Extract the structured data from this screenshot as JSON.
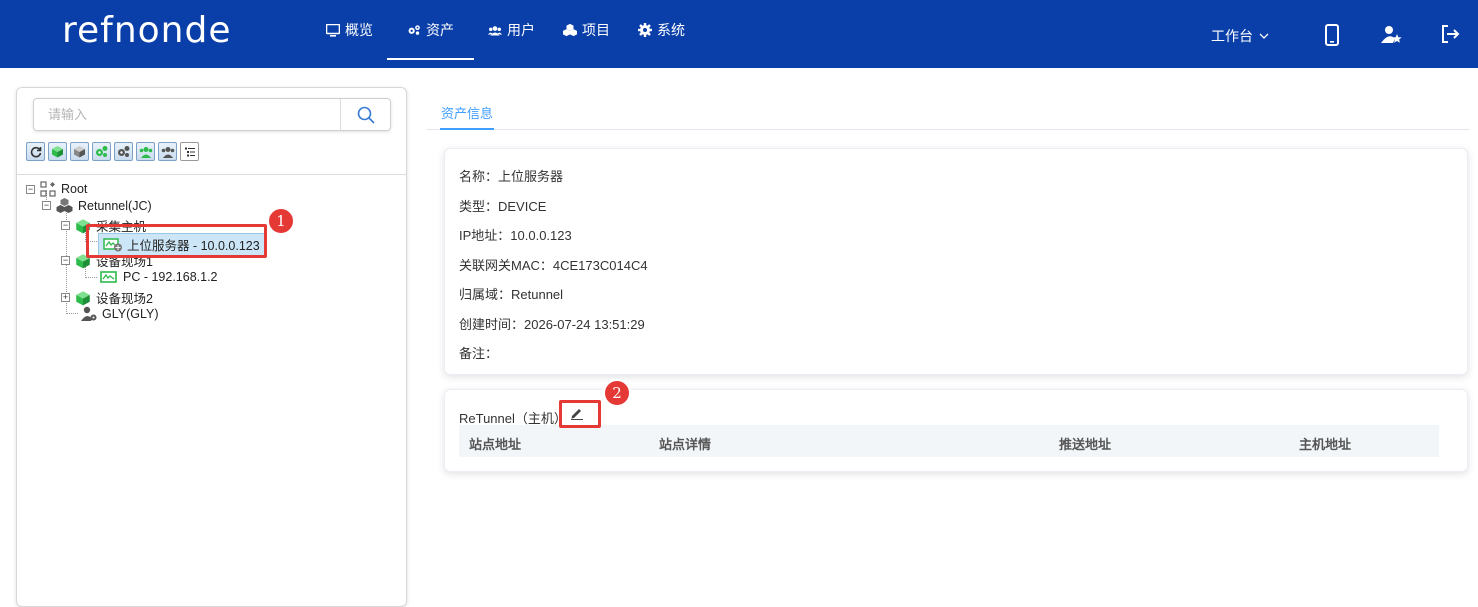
{
  "app": {
    "logo_text": "refnonde"
  },
  "nav": {
    "items": [
      {
        "label": "概览",
        "icon": "monitor-icon"
      },
      {
        "label": "资产",
        "icon": "gears-icon"
      },
      {
        "label": "用户",
        "icon": "users-icon"
      },
      {
        "label": "项目",
        "icon": "cubes-icon"
      },
      {
        "label": "系统",
        "icon": "gear-icon"
      }
    ],
    "active": "资产",
    "workbench_label": "工作台",
    "right_icons": [
      "mobile-icon",
      "user-star-icon",
      "logout-icon"
    ]
  },
  "search": {
    "placeholder": "请输入",
    "value": ""
  },
  "toolbar": {
    "buttons": [
      "refresh-icon",
      "add-green-cube-icon",
      "add-gray-cube-icon",
      "add-green-gears-icon",
      "add-gray-gears-icon",
      "add-green-users-icon",
      "add-gray-users-icon",
      "list-icon"
    ]
  },
  "tree": {
    "root": "Root",
    "retunnel": "Retunnel(JC)",
    "collector": "采集主机",
    "server": "上位服务器 - 10.0.0.123",
    "site1": "设备现场1",
    "pc": "PC - 192.168.1.2",
    "site2": "设备现场2",
    "gly": "GLY(GLY)"
  },
  "annotations": {
    "badge1": "1",
    "badge2": "2"
  },
  "tabs": {
    "asset_info": "资产信息"
  },
  "asset": {
    "name": "名称：上位服务器",
    "type": "类型：DEVICE",
    "ip": "IP地址：10.0.0.123",
    "mac": "关联网关MAC：4CE173C014C4",
    "domain": "归属域：Retunnel",
    "created": "创建时间：2026-07-24 13:51:29",
    "note": "备注："
  },
  "host": {
    "title": "ReTunnel（主机）",
    "columns": [
      "站点地址",
      "站点详情",
      "推送地址",
      "主机地址"
    ]
  },
  "colors": {
    "nav_bg": "#0a3fa9",
    "accent": "#409eff",
    "annotation": "#e53935",
    "tree_green": "#2dbb4b"
  }
}
